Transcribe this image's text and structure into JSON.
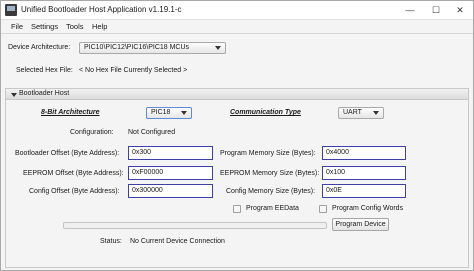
{
  "window": {
    "title": "Unified Bootloader Host Application v1.19.1-c",
    "controls": {
      "minimize": "—",
      "maximize": "☐",
      "close": "✕"
    }
  },
  "menu": {
    "file": "File",
    "settings": "Settings",
    "tools": "Tools",
    "help": "Help"
  },
  "top": {
    "device_architecture_label": "Device Architecture:",
    "device_architecture_value": "PIC10\\PIC12\\PIC16\\PIC18 MCUs",
    "selected_hex_label": "Selected Hex File:",
    "selected_hex_value": "< No Hex File Currently Selected >"
  },
  "bootloader": {
    "header": "Bootloader Host",
    "arch_label": "8-Bit Architecture",
    "arch_value": "PIC18",
    "comm_label": "Communication Type",
    "comm_value": "UART",
    "configuration_label": "Configuration:",
    "configuration_value": "Not Configured",
    "bootloader_offset_label": "Bootloader Offset (Byte Address):",
    "bootloader_offset_value": "0x300",
    "eeprom_offset_label": "EEPROM Offset (Byte Address):",
    "eeprom_offset_value": "0xF00000",
    "config_offset_label": "Config Offset (Byte Address):",
    "config_offset_value": "0x300000",
    "program_mem_label": "Program Memory Size (Bytes):",
    "program_mem_value": "0x4000",
    "eeprom_mem_label": "EEPROM Memory Size (Bytes):",
    "eeprom_mem_value": "0x100",
    "config_mem_label": "Config Memory Size (Bytes):",
    "config_mem_value": "0x0E",
    "program_eedata_label": "Program EEData",
    "program_config_words_label": "Program Config Words",
    "program_device_button": "Program Device",
    "status_label": "Status:",
    "status_value": "No Current Device Connection",
    "progress": 0
  }
}
